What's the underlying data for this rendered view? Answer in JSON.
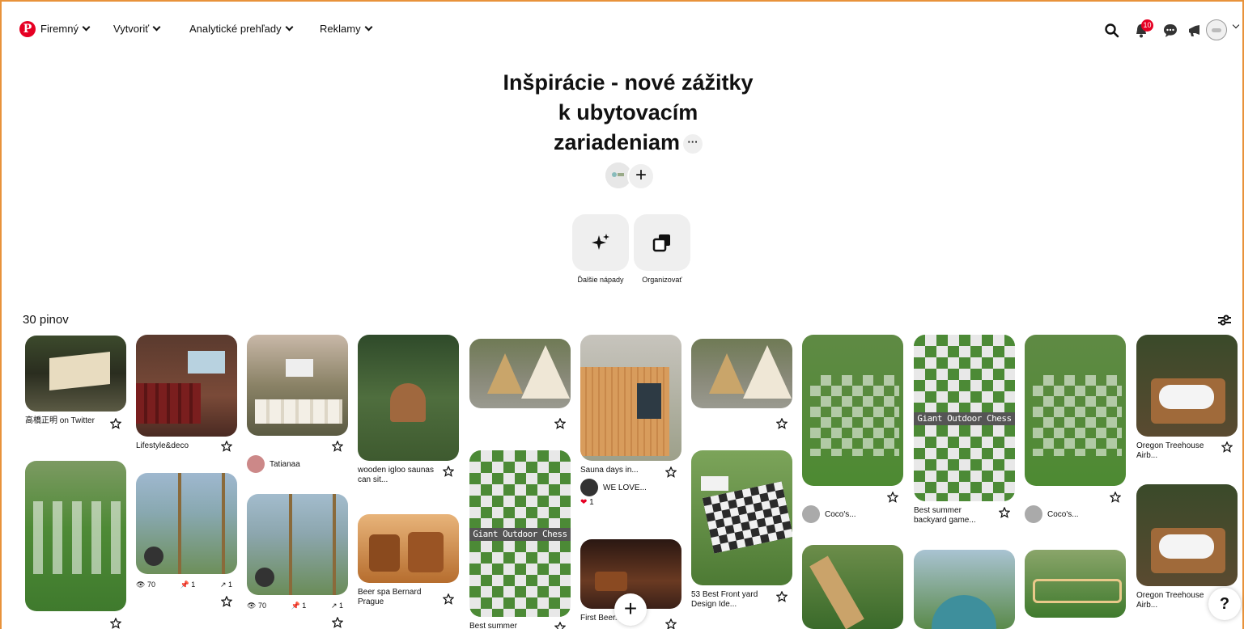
{
  "nav": {
    "logo": "P",
    "items": [
      {
        "label": "Firemný"
      },
      {
        "label": "Vytvoriť"
      },
      {
        "label": "Analytické prehľady"
      },
      {
        "label": "Reklamy"
      }
    ],
    "notification_count": "10",
    "icons": [
      "search-icon",
      "bell-icon",
      "chat-icon",
      "megaphone-icon",
      "avatar",
      "chevron-down-icon"
    ]
  },
  "board": {
    "title_line1": "Inšpirácie - nové zážitky",
    "title_line2": "k ubytovacím",
    "title_line3": "zariadeniam",
    "more": "···",
    "add": "+",
    "actions": [
      {
        "label": "Ďalšie nápady",
        "icon": "sparkle-icon"
      },
      {
        "label": "Organizovať",
        "icon": "organize-icon"
      }
    ],
    "pin_count": "30 pinov"
  },
  "pins": {
    "p1": {
      "title": "高橋正明 on Twitter"
    },
    "p2": {
      "title": "Lifestyle&deco"
    },
    "p3": {
      "creator": "Tatianaa"
    },
    "p4": {
      "title": "wooden igloo saunas can sit..."
    },
    "p5": {
      "title": "Beer spa Bernard Prague"
    },
    "p6": {
      "title": "Sauna days in...",
      "creator": "WE LOVE...",
      "likes": "1"
    },
    "p7": {
      "title": "First Beer..."
    },
    "p8": {
      "title": "53 Best Front yard Design Ide..."
    },
    "p9": {
      "creator": "Coco's..."
    },
    "p10": {
      "title": "Best summer backyard game..."
    },
    "p11": {
      "creator": "Coco's..."
    },
    "p12": {
      "title": "Oregon Treehouse Airb..."
    },
    "p13": {
      "title": "Oregon Treehouse Airb..."
    },
    "p14": {
      "title": "Best summer"
    },
    "stats_a": {
      "views": "70",
      "saves": "1",
      "clicks": "1"
    },
    "stats_b": {
      "views": "70",
      "saves": "1",
      "clicks": "1"
    },
    "chess_banner": "Giant Outdoor Chess"
  },
  "fab": {
    "add": "+",
    "help": "?"
  },
  "colors": {
    "brand": "#e60023",
    "frame": "#e8923a",
    "chip": "#efefef"
  }
}
